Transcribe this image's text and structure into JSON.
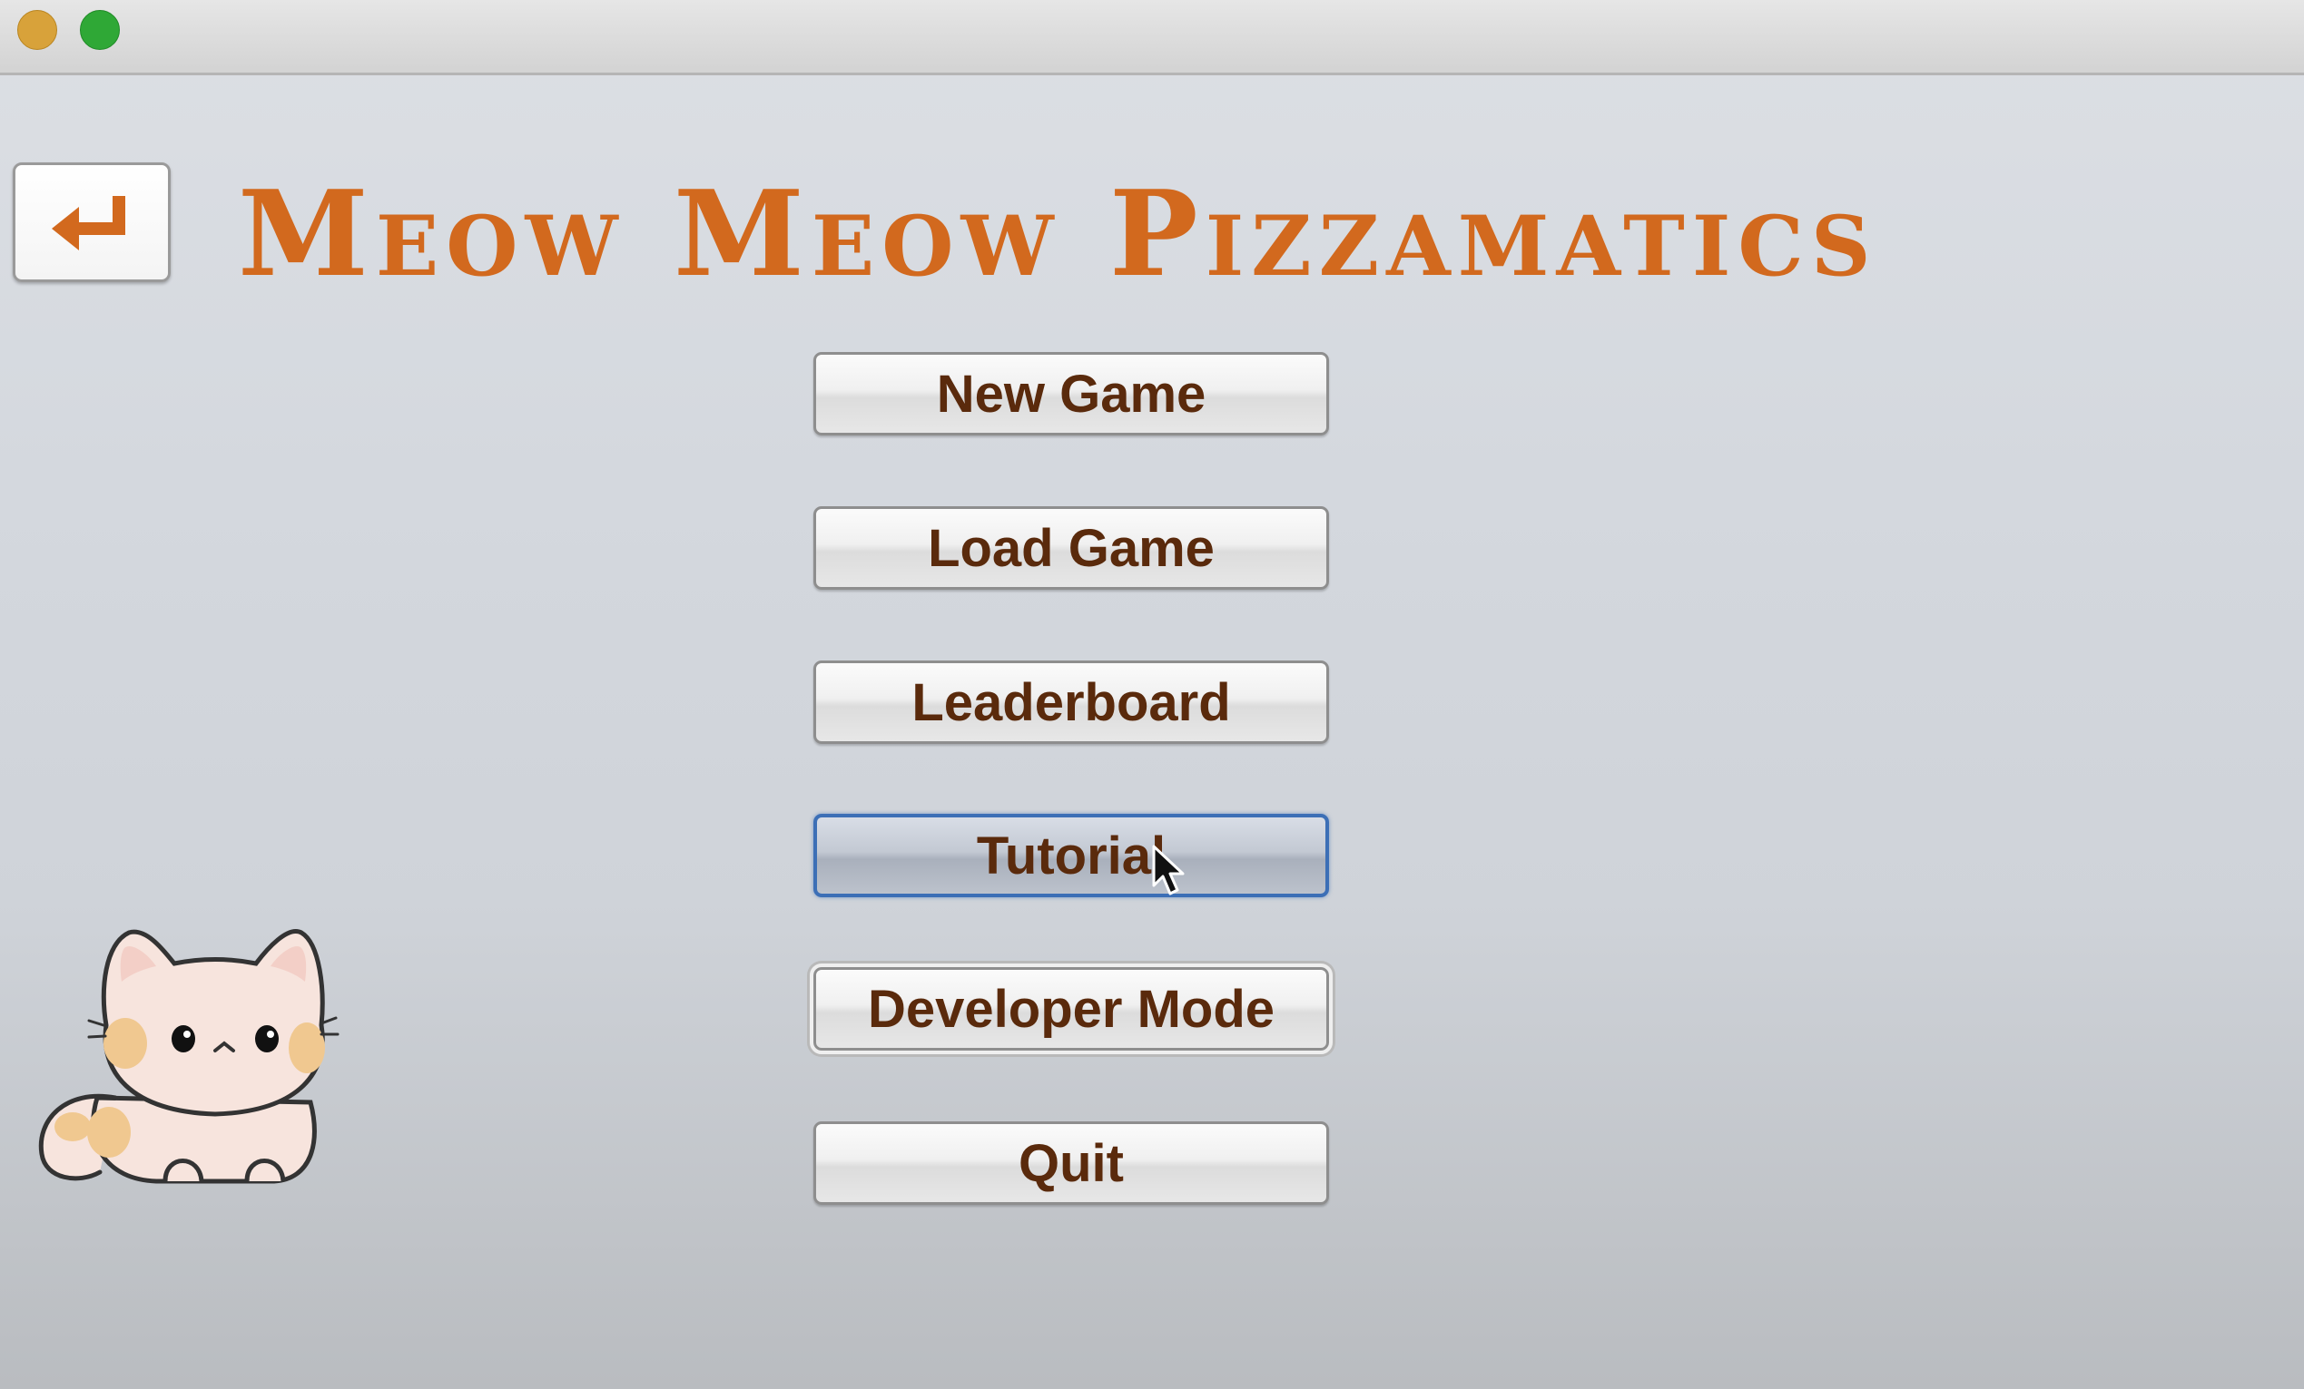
{
  "window": {
    "controls": [
      "minimize",
      "zoom"
    ]
  },
  "header": {
    "back_icon": "return-arrow-icon",
    "title": "Meow Meow Pizzamatics"
  },
  "menu": {
    "items": [
      {
        "label": "New Game",
        "state": "normal"
      },
      {
        "label": "Load Game",
        "state": "normal"
      },
      {
        "label": "Leaderboard",
        "state": "normal"
      },
      {
        "label": "Tutorial",
        "state": "hovered"
      },
      {
        "label": "Developer Mode",
        "state": "focused"
      },
      {
        "label": "Quit",
        "state": "normal"
      }
    ]
  },
  "decoration": {
    "mascot": "cat-illustration"
  },
  "colors": {
    "title": "#d2691e",
    "button_text": "#5a2a0c",
    "selected_border": "#3c6fb6"
  }
}
